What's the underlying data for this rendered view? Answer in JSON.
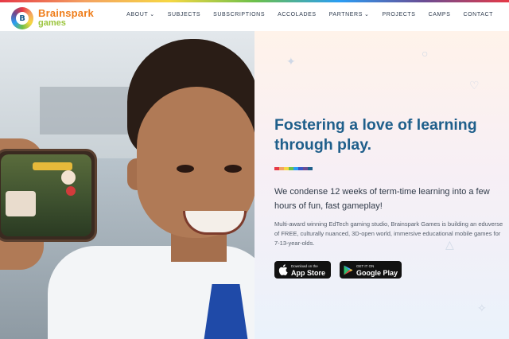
{
  "brand": {
    "name": "Brainspark",
    "sub": "games",
    "mark_letter": "B"
  },
  "nav": {
    "items": [
      {
        "label": "ABOUT",
        "dropdown": true
      },
      {
        "label": "SUBJECTS",
        "dropdown": false
      },
      {
        "label": "SUBSCRIPTIONS",
        "dropdown": false
      },
      {
        "label": "ACCOLADES",
        "dropdown": false
      },
      {
        "label": "PARTNERS",
        "dropdown": true
      },
      {
        "label": "PROJECTS",
        "dropdown": false
      },
      {
        "label": "CAMPS",
        "dropdown": false
      },
      {
        "label": "CONTACT",
        "dropdown": false
      }
    ]
  },
  "hero": {
    "headline_line1": "Fostering a love of learning",
    "headline_line2": "through play.",
    "lead": "We condense 12 weeks of term-time learning into a few hours of fun, fast gameplay!",
    "body": "Multi-award winning EdTech gaming studio, Brainspark Games is building an eduverse of FREE, culturally nuanced, 3D-open world, immersive educational mobile games for 7-13-year-olds.",
    "divider_colors": [
      "#e63946",
      "#f4a261",
      "#f6d743",
      "#6cc04a",
      "#2a9df4",
      "#3a56c5",
      "#6a4c93",
      "#1f5f8b"
    ]
  },
  "stores": {
    "apple": {
      "small": "Download on the",
      "big": "App Store",
      "icon": "apple-icon"
    },
    "google": {
      "small": "GET IT ON",
      "big": "Google Play",
      "icon": "google-play-icon"
    }
  },
  "colors": {
    "headline": "#1f5f8b",
    "brand_orange": "#ef7d1a",
    "brand_green": "#9bc53d"
  }
}
